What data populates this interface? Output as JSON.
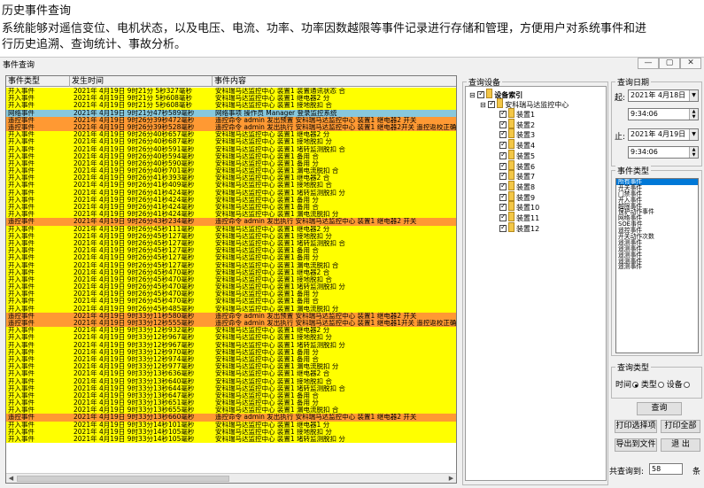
{
  "caption": {
    "title": "历史事件查询",
    "desc1": "系统能够对遥信变位、电机状态，以及电压、电流、功率、功率因数越限等事件记录进行存储和管理，方便用户对系统事件和进",
    "desc2": "行历史追溯、查询统计、事故分析。"
  },
  "window": {
    "title": "事件查询",
    "min_label": "—",
    "max_label": "▢",
    "close_label": "✕"
  },
  "table": {
    "headers": [
      "事件类型",
      "发生时间",
      "事件内容"
    ],
    "colors": {
      "yellow": "#ffff00",
      "orange": "#ff9933",
      "blue": "#88c8dc",
      "select": "#ffd400"
    },
    "rows": [
      [
        "yellow",
        "开入事件",
        "2021年 4月19日  9时21分 5秒327毫秒",
        "安科瑞马达监控中心 装置1 装置通讯状态 合"
      ],
      [
        "yellow",
        "开入事件",
        "2021年 4月19日  9时21分 5秒608毫秒",
        "安科瑞马达监控中心 装置1 继电器2 分"
      ],
      [
        "yellow",
        "开入事件",
        "2021年 4月19日  9时21分 5秒608毫秒",
        "安科瑞马达监控中心 装置1 接地脱扣 合"
      ],
      [
        "blue",
        "网络事件",
        "2021年 4月19日  9时21分47秒589毫秒",
        "网络事项 操作员 Manager 登录监控系统"
      ],
      [
        "orange",
        "遥控事件",
        "2021年 4月19日  9时26分39秒472毫秒",
        "遥控命令 admin 发出预置 安科瑞马达监控中心 装置1 继电器2 开关"
      ],
      [
        "orange",
        "遥控事件",
        "2021年 4月19日  9时26分39秒528毫秒",
        "遥控命令 admin 发出执行 安科瑞马达监控中心 装置1 继电器2开关 遥控返校正确 合"
      ],
      [
        "yellow",
        "开入事件",
        "2021年 4月19日  9时26分40秒657毫秒",
        "安科瑞马达监控中心 装置1 继电器2 分"
      ],
      [
        "yellow",
        "开入事件",
        "2021年 4月19日  9时26分40秒687毫秒",
        "安科瑞马达监控中心 装置1 接地脱扣 分"
      ],
      [
        "yellow",
        "开入事件",
        "2021年 4月19日  9时26分40秒591毫秒",
        "安科瑞马达监控中心 装置1 堵转监测脱扣 合"
      ],
      [
        "yellow",
        "开入事件",
        "2021年 4月19日  9时26分40秒594毫秒",
        "安科瑞马达监控中心 装置1 备用 合"
      ],
      [
        "yellow",
        "开入事件",
        "2021年 4月19日  9时26分40秒590毫秒",
        "安科瑞马达监控中心 装置1 备用 分"
      ],
      [
        "yellow",
        "开入事件",
        "2021年 4月19日  9时26分40秒701毫秒",
        "安科瑞马达监控中心 装置1 漏电流脱扣 合"
      ],
      [
        "yellow",
        "开入事件",
        "2021年 4月19日  9时26分41秒393毫秒",
        "安科瑞马达监控中心 装置1 继电器2 合"
      ],
      [
        "yellow",
        "开入事件",
        "2021年 4月19日  9时26分41秒409毫秒",
        "安科瑞马达监控中心 装置1 接地脱扣 合"
      ],
      [
        "yellow",
        "开入事件",
        "2021年 4月19日  9时26分41秒424毫秒",
        "安科瑞马达监控中心 装置1 堵转监测脱扣 分"
      ],
      [
        "yellow",
        "开入事件",
        "2021年 4月19日  9时26分41秒424毫秒",
        "安科瑞马达监控中心 装置1 备用 分"
      ],
      [
        "yellow",
        "开入事件",
        "2021年 4月19日  9时26分41秒424毫秒",
        "安科瑞马达监控中心 装置1 备用 合"
      ],
      [
        "yellow",
        "开入事件",
        "2021年 4月19日  9时26分41秒424毫秒",
        "安科瑞马达监控中心 装置1 漏电流脱扣 分"
      ],
      [
        "orange",
        "遥控事件",
        "2021年 4月19日  9时26分43秒234毫秒",
        "遥控命令 admin 发出执行 安科瑞马达监控中心 装置1 继电器2 开关"
      ],
      [
        "yellow",
        "开入事件",
        "2021年 4月19日  9时26分45秒111毫秒",
        "安科瑞马达监控中心 装置1 继电器2 分"
      ],
      [
        "yellow",
        "开入事件",
        "2021年 4月19日  9时26分45秒127毫秒",
        "安科瑞马达监控中心 装置1 接地脱扣 分"
      ],
      [
        "yellow",
        "开入事件",
        "2021年 4月19日  9时26分45秒127毫秒",
        "安科瑞马达监控中心 装置1 堵转监测脱扣 合"
      ],
      [
        "yellow",
        "开入事件",
        "2021年 4月19日  9时26分45秒127毫秒",
        "安科瑞马达监控中心 装置1 备用 合"
      ],
      [
        "yellow",
        "开入事件",
        "2021年 4月19日  9时26分45秒127毫秒",
        "安科瑞马达监控中心 装置1 备用 分"
      ],
      [
        "yellow",
        "开入事件",
        "2021年 4月19日  9时26分45秒127毫秒",
        "安科瑞马达监控中心 装置1 漏电流脱扣 合"
      ],
      [
        "yellow",
        "开入事件",
        "2021年 4月19日  9时26分45秒470毫秒",
        "安科瑞马达监控中心 装置1 继电器2 合"
      ],
      [
        "yellow",
        "开入事件",
        "2021年 4月19日  9时26分45秒470毫秒",
        "安科瑞马达监控中心 装置1 接地脱扣 合"
      ],
      [
        "yellow",
        "开入事件",
        "2021年 4月19日  9时26分45秒470毫秒",
        "安科瑞马达监控中心 装置1 堵转监测脱扣 分"
      ],
      [
        "yellow",
        "开入事件",
        "2021年 4月19日  9时26分45秒470毫秒",
        "安科瑞马达监控中心 装置1 备用 分"
      ],
      [
        "yellow",
        "开入事件",
        "2021年 4月19日  9时26分45秒470毫秒",
        "安科瑞马达监控中心 装置1 备用 合"
      ],
      [
        "yellow",
        "开入事件",
        "2021年 4月19日  9时26分45秒485毫秒",
        "安科瑞马达监控中心 装置1 漏电流脱扣 分"
      ],
      [
        "orange",
        "遥控事件",
        "2021年 4月19日  9时33分11秒580毫秒",
        "遥控命令 admin 发出预置 安科瑞马达监控中心 装置1 继电器2 开关"
      ],
      [
        "orange",
        "遥控事件",
        "2021年 4月19日  9时33分12秒555毫秒",
        "遥控命令 admin 发出执行 安科瑞马达监控中心 装置1 继电器1开关 遥控返校正确 分"
      ],
      [
        "yellow",
        "开入事件",
        "2021年 4月19日  9时33分12秒932毫秒",
        "安科瑞马达监控中心 装置1 继电器2 分"
      ],
      [
        "yellow",
        "开入事件",
        "2021年 4月19日  9时33分12秒967毫秒",
        "安科瑞马达监控中心 装置1 接地脱扣 分"
      ],
      [
        "yellow",
        "开入事件",
        "2021年 4月19日  9时33分12秒967毫秒",
        "安科瑞马达监控中心 装置1 堵转监测脱扣 分"
      ],
      [
        "yellow",
        "开入事件",
        "2021年 4月19日  9时33分12秒970毫秒",
        "安科瑞马达监控中心 装置1 备用 分"
      ],
      [
        "yellow",
        "开入事件",
        "2021年 4月19日  9时33分12秒974毫秒",
        "安科瑞马达监控中心 装置1 备用 合"
      ],
      [
        "yellow",
        "开入事件",
        "2021年 4月19日  9时33分12秒977毫秒",
        "安科瑞马达监控中心 装置1 漏电流脱扣 分"
      ],
      [
        "yellow",
        "开入事件",
        "2021年 4月19日  9时33分13秒636毫秒",
        "安科瑞马达监控中心 装置1 继电器2 合"
      ],
      [
        "yellow",
        "开入事件",
        "2021年 4月19日  9时33分13秒640毫秒",
        "安科瑞马达监控中心 装置1 接地脱扣 合"
      ],
      [
        "yellow",
        "开入事件",
        "2021年 4月19日  9时33分13秒644毫秒",
        "安科瑞马达监控中心 装置1 堵转监测脱扣 合"
      ],
      [
        "yellow",
        "开入事件",
        "2021年 4月19日  9时33分13秒647毫秒",
        "安科瑞马达监控中心 装置1 备用 合"
      ],
      [
        "yellow",
        "开入事件",
        "2021年 4月19日  9时33分13秒651毫秒",
        "安科瑞马达监控中心 装置1 备用 分"
      ],
      [
        "yellow",
        "开入事件",
        "2021年 4月19日  9时33分13秒655毫秒",
        "安科瑞马达监控中心 装置1 漏电流脱扣 合"
      ],
      [
        "orange",
        "遥控事件",
        "2021年 4月19日  9时33分13秒660毫秒",
        "遥控命令 admin 发出执行 安科瑞马达监控中心 装置1 继电器2 开关"
      ],
      [
        "yellow",
        "开入事件",
        "2021年 4月19日  9时33分14秒101毫秒",
        "安科瑞马达监控中心 装置1 继电器1 分"
      ],
      [
        "yellow",
        "开入事件",
        "2021年 4月19日  9时33分14秒105毫秒",
        "安科瑞马达监控中心 装置1 接地脱扣 分"
      ],
      [
        "yellow",
        "开入事件",
        "2021年 4月19日  9时33分14秒105毫秒",
        "安科瑞马达监控中心 装置1 堵转监测脱扣 分"
      ]
    ]
  },
  "device_group": {
    "label": "查询设备",
    "root": "设备索引",
    "center": "安科瑞马达监控中心",
    "devices": [
      "装置1",
      "装置2",
      "装置3",
      "装置4",
      "装置5",
      "装置6",
      "装置7",
      "装置8",
      "装置9",
      "装置10",
      "装置11",
      "装置12"
    ]
  },
  "date_group": {
    "label": "查询日期",
    "start_label": "起:",
    "start_date": "2021年 4月18日",
    "start_time": "9:34:06",
    "end_label": "止:",
    "end_date": "2021年 4月19日",
    "end_time": "9:34:06"
  },
  "type_group": {
    "label": "事件类型",
    "items": [
      "所有事件",
      "开关事件",
      "门禁事件",
      "开入事件",
      "越限事件",
      "保护动作事件",
      "网络事件",
      "SOE事件",
      "遥控事件",
      "开关动作次数",
      "遥测事件",
      "遥测事件",
      "遥测事件",
      "遥测事件",
      "遥测事件"
    ]
  },
  "qtype_group": {
    "label": "查询类型",
    "opt_time": "时间",
    "opt_type": "类型",
    "opt_device": "设备"
  },
  "buttons": {
    "query": "查询",
    "print_sel": "打印选择项",
    "print_all": "打印全部",
    "export": "导出到文件",
    "exit": "退 出"
  },
  "count": {
    "label": "共查询到:",
    "value": "58",
    "unit": "条"
  }
}
